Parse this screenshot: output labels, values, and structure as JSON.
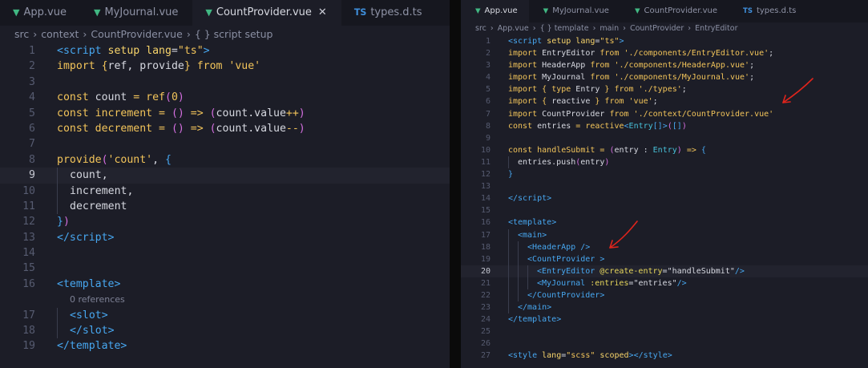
{
  "left_editor": {
    "tabs": [
      {
        "icon": "vue",
        "label": "App.vue",
        "active": false
      },
      {
        "icon": "vue",
        "label": "MyJournal.vue",
        "active": false
      },
      {
        "icon": "vue",
        "label": "CountProvider.vue",
        "active": true,
        "closable": true
      },
      {
        "icon": "ts",
        "icon_text": "TS",
        "label": "types.d.ts",
        "active": false
      }
    ],
    "breadcrumbs": [
      "src",
      "context",
      "CountProvider.vue",
      "{ } script setup"
    ],
    "current_line": 9,
    "lines": [
      {
        "n": "1",
        "indent": 0,
        "t": [
          [
            "tag",
            "<script"
          ],
          [
            "attr",
            " setup"
          ],
          [
            "attr",
            " lang"
          ],
          [
            "pn",
            "="
          ],
          [
            "str",
            "\"ts\""
          ],
          [
            "tag",
            ">"
          ]
        ]
      },
      {
        "n": "2",
        "indent": 0,
        "t": [
          [
            "kw",
            "import"
          ],
          [
            "br1",
            " {"
          ],
          [
            "id",
            "ref"
          ],
          [
            "pn",
            ", "
          ],
          [
            "id",
            "provide"
          ],
          [
            "br1",
            "}"
          ],
          [
            "kw",
            " from"
          ],
          [
            "str",
            " 'vue'"
          ]
        ]
      },
      {
        "n": "3",
        "indent": 0,
        "t": []
      },
      {
        "n": "4",
        "indent": 0,
        "t": [
          [
            "kw",
            "const"
          ],
          [
            "id",
            " count"
          ],
          [
            "op",
            " ="
          ],
          [
            "fn",
            " ref"
          ],
          [
            "br2",
            "("
          ],
          [
            "num",
            "0"
          ],
          [
            "br2",
            ")"
          ]
        ]
      },
      {
        "n": "5",
        "indent": 0,
        "t": [
          [
            "kw",
            "const"
          ],
          [
            "fn",
            " increment"
          ],
          [
            "op",
            " ="
          ],
          [
            "br2",
            " ()"
          ],
          [
            "op",
            " =>"
          ],
          [
            "br2",
            " ("
          ],
          [
            "id",
            "count.value"
          ],
          [
            "op",
            "++"
          ],
          [
            "br2",
            ")"
          ]
        ]
      },
      {
        "n": "6",
        "indent": 0,
        "t": [
          [
            "kw",
            "const"
          ],
          [
            "fn",
            " decrement"
          ],
          [
            "op",
            " ="
          ],
          [
            "br2",
            " ()"
          ],
          [
            "op",
            " =>"
          ],
          [
            "br2",
            " ("
          ],
          [
            "id",
            "count.value"
          ],
          [
            "op",
            "--"
          ],
          [
            "br2",
            ")"
          ]
        ]
      },
      {
        "n": "7",
        "indent": 0,
        "t": []
      },
      {
        "n": "8",
        "indent": 0,
        "t": [
          [
            "fn",
            "provide"
          ],
          [
            "br2",
            "("
          ],
          [
            "str",
            "'count'"
          ],
          [
            "pn",
            ", "
          ],
          [
            "br3",
            "{"
          ]
        ]
      },
      {
        "n": "9",
        "indent": 1,
        "t": [
          [
            "id",
            "count"
          ],
          [
            "pn",
            ","
          ]
        ]
      },
      {
        "n": "10",
        "indent": 1,
        "t": [
          [
            "id",
            "increment"
          ],
          [
            "pn",
            ","
          ]
        ]
      },
      {
        "n": "11",
        "indent": 1,
        "t": [
          [
            "id",
            "decrement"
          ]
        ]
      },
      {
        "n": "12",
        "indent": 0,
        "t": [
          [
            "br3",
            "}"
          ],
          [
            "br2",
            ")"
          ]
        ]
      },
      {
        "n": "13",
        "indent": 0,
        "t": [
          [
            "tag",
            "</script"
          ],
          [
            "tag",
            ">"
          ]
        ]
      },
      {
        "n": "14",
        "indent": 0,
        "t": []
      },
      {
        "n": "15",
        "indent": 0,
        "t": []
      },
      {
        "n": "16",
        "indent": 0,
        "t": [
          [
            "tag",
            "<template"
          ],
          [
            "tag",
            ">"
          ]
        ]
      },
      {
        "n": "",
        "indent": 0,
        "ref": "0 references",
        "t": []
      },
      {
        "n": "17",
        "indent": 1,
        "t": [
          [
            "tag",
            "<slot"
          ],
          [
            "tag",
            ">"
          ]
        ]
      },
      {
        "n": "18",
        "indent": 1,
        "t": [
          [
            "tag",
            "</slot"
          ],
          [
            "tag",
            ">"
          ]
        ]
      },
      {
        "n": "19",
        "indent": 0,
        "t": [
          [
            "tag",
            "</template"
          ],
          [
            "tag",
            ">"
          ]
        ]
      }
    ]
  },
  "right_editor": {
    "tabs": [
      {
        "icon": "vue",
        "label": "App.vue",
        "active": true,
        "closable": true
      },
      {
        "icon": "vue",
        "label": "MyJournal.vue",
        "active": false
      },
      {
        "icon": "vue",
        "label": "CountProvider.vue",
        "active": false,
        "italic": true
      },
      {
        "icon": "ts",
        "icon_text": "TS",
        "label": "types.d.ts",
        "active": false
      }
    ],
    "breadcrumbs": [
      "src",
      "App.vue",
      "{ } template",
      "main",
      "CountProvider",
      "EntryEditor"
    ],
    "current_line": 20,
    "lines": [
      {
        "n": "1",
        "indent": 0,
        "t": [
          [
            "tag",
            "<script"
          ],
          [
            "attr",
            " setup"
          ],
          [
            "attr",
            " lang"
          ],
          [
            "pn",
            "="
          ],
          [
            "str",
            "\"ts\""
          ],
          [
            "tag",
            ">"
          ]
        ]
      },
      {
        "n": "2",
        "indent": 0,
        "t": [
          [
            "kw",
            "import"
          ],
          [
            "id",
            " EntryEditor"
          ],
          [
            "kw",
            " from"
          ],
          [
            "str",
            " './components/EntryEditor.vue'"
          ],
          [
            "pn",
            ";"
          ]
        ]
      },
      {
        "n": "3",
        "indent": 0,
        "t": [
          [
            "kw",
            "import"
          ],
          [
            "id",
            " HeaderApp"
          ],
          [
            "kw",
            " from"
          ],
          [
            "str",
            " './components/HeaderApp.vue'"
          ],
          [
            "pn",
            ";"
          ]
        ]
      },
      {
        "n": "4",
        "indent": 0,
        "t": [
          [
            "kw",
            "import"
          ],
          [
            "id",
            " MyJournal"
          ],
          [
            "kw",
            " from"
          ],
          [
            "str",
            " './components/MyJournal.vue'"
          ],
          [
            "pn",
            ";"
          ]
        ]
      },
      {
        "n": "5",
        "indent": 0,
        "t": [
          [
            "kw",
            "import"
          ],
          [
            "br1",
            " {"
          ],
          [
            "kw",
            " type"
          ],
          [
            "id",
            " Entry"
          ],
          [
            "br1",
            " }"
          ],
          [
            "kw",
            " from"
          ],
          [
            "str",
            " './types'"
          ],
          [
            "pn",
            ";"
          ]
        ]
      },
      {
        "n": "6",
        "indent": 0,
        "t": [
          [
            "kw",
            "import"
          ],
          [
            "br1",
            " {"
          ],
          [
            "id",
            " reactive"
          ],
          [
            "br1",
            " }"
          ],
          [
            "kw",
            " from"
          ],
          [
            "str",
            " 'vue'"
          ],
          [
            "pn",
            ";"
          ]
        ]
      },
      {
        "n": "7",
        "indent": 0,
        "t": [
          [
            "kw",
            "import"
          ],
          [
            "id",
            " CountProvider"
          ],
          [
            "kw",
            " from"
          ],
          [
            "str",
            " './context/CountProvider.vue'"
          ]
        ]
      },
      {
        "n": "8",
        "indent": 0,
        "t": [
          [
            "kw",
            "const"
          ],
          [
            "id",
            " entries"
          ],
          [
            "op",
            " ="
          ],
          [
            "fn",
            " reactive"
          ],
          [
            "tag",
            "<"
          ],
          [
            "type",
            "Entry"
          ],
          [
            "br3",
            "[]"
          ],
          [
            "tag",
            ">"
          ],
          [
            "br2",
            "("
          ],
          [
            "br3",
            "[]"
          ],
          [
            "br2",
            ")"
          ]
        ]
      },
      {
        "n": "9",
        "indent": 0,
        "t": []
      },
      {
        "n": "10",
        "indent": 0,
        "t": [
          [
            "kw",
            "const"
          ],
          [
            "fn",
            " handleSubmit"
          ],
          [
            "op",
            " ="
          ],
          [
            "br2",
            " ("
          ],
          [
            "id",
            "entry"
          ],
          [
            "pn",
            " :"
          ],
          [
            "type",
            " Entry"
          ],
          [
            "br2",
            ")"
          ],
          [
            "op",
            " =>"
          ],
          [
            "br3",
            " {"
          ]
        ]
      },
      {
        "n": "11",
        "indent": 1,
        "t": [
          [
            "id",
            "entries.push"
          ],
          [
            "br2",
            "("
          ],
          [
            "id",
            "entry"
          ],
          [
            "br2",
            ")"
          ]
        ]
      },
      {
        "n": "12",
        "indent": 0,
        "t": [
          [
            "br3",
            "}"
          ]
        ]
      },
      {
        "n": "13",
        "indent": 0,
        "t": []
      },
      {
        "n": "14",
        "indent": 0,
        "t": [
          [
            "tag",
            "</script"
          ],
          [
            "tag",
            ">"
          ]
        ]
      },
      {
        "n": "15",
        "indent": 0,
        "t": []
      },
      {
        "n": "16",
        "indent": 0,
        "t": [
          [
            "tag",
            "<template"
          ],
          [
            "tag",
            ">"
          ]
        ]
      },
      {
        "n": "17",
        "indent": 1,
        "t": [
          [
            "tag",
            "<main"
          ],
          [
            "tag",
            ">"
          ]
        ]
      },
      {
        "n": "18",
        "indent": 2,
        "t": [
          [
            "tag",
            "<HeaderApp"
          ],
          [
            "tag",
            " />"
          ]
        ]
      },
      {
        "n": "19",
        "indent": 2,
        "t": [
          [
            "tag",
            "<CountProvider"
          ],
          [
            "tag",
            " >"
          ]
        ]
      },
      {
        "n": "20",
        "indent": 3,
        "t": [
          [
            "tag",
            "<EntryEditor"
          ],
          [
            "dir",
            " @create-entry"
          ],
          [
            "pn",
            "="
          ],
          [
            "id",
            "\"handleSubmit\""
          ],
          [
            "tag",
            "/>"
          ]
        ]
      },
      {
        "n": "21",
        "indent": 3,
        "t": [
          [
            "tag",
            "<MyJournal"
          ],
          [
            "dir",
            " :entries"
          ],
          [
            "pn",
            "="
          ],
          [
            "id",
            "\"entries\""
          ],
          [
            "tag",
            "/>"
          ]
        ]
      },
      {
        "n": "22",
        "indent": 2,
        "t": [
          [
            "tag",
            "</CountProvider"
          ],
          [
            "tag",
            ">"
          ]
        ]
      },
      {
        "n": "23",
        "indent": 1,
        "t": [
          [
            "tag",
            "</main"
          ],
          [
            "tag",
            ">"
          ]
        ]
      },
      {
        "n": "24",
        "indent": 0,
        "t": [
          [
            "tag",
            "</template"
          ],
          [
            "tag",
            ">"
          ]
        ]
      },
      {
        "n": "25",
        "indent": 0,
        "t": []
      },
      {
        "n": "26",
        "indent": 0,
        "t": []
      },
      {
        "n": "27",
        "indent": 0,
        "t": [
          [
            "tag",
            "<style"
          ],
          [
            "attr",
            " lang"
          ],
          [
            "pn",
            "="
          ],
          [
            "str",
            "\"scss\""
          ],
          [
            "attr",
            " scoped"
          ],
          [
            "tag",
            "></style"
          ],
          [
            "tag",
            ">"
          ]
        ]
      }
    ]
  },
  "annotations": {
    "arrow_color": "#e0241c"
  }
}
